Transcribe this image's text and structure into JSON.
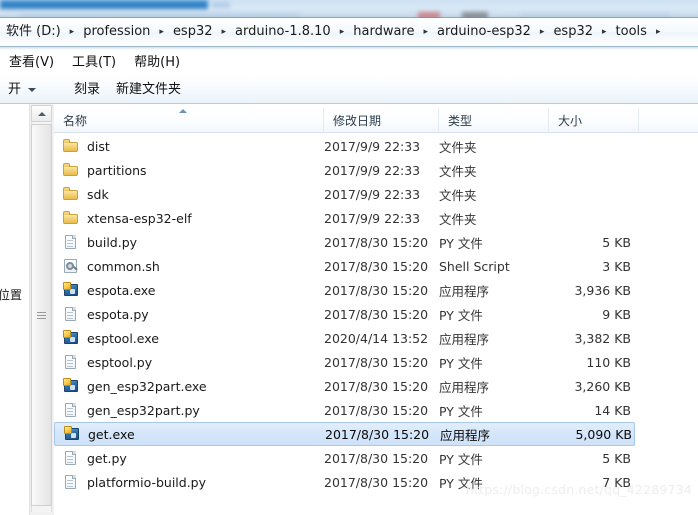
{
  "window": {
    "address_bar": {
      "crumbs": [
        "软件 (D:)",
        "profession",
        "esp32",
        "arduino-1.8.10",
        "hardware",
        "arduino-esp32",
        "esp32",
        "tools"
      ],
      "separator": "▸"
    },
    "menu": [
      {
        "label": "查看(V)"
      },
      {
        "label": "工具(T)"
      },
      {
        "label": "帮助(H)"
      }
    ],
    "toolbar": [
      {
        "label": "开",
        "icon": "chevron-down-icon"
      },
      {
        "label": "刻录"
      },
      {
        "label": "新建文件夹"
      }
    ],
    "nav_pane": {
      "clipped_label": "位置"
    }
  },
  "list": {
    "columns": [
      {
        "key": "name",
        "label": "名称",
        "sorted": "asc"
      },
      {
        "key": "date",
        "label": "修改日期"
      },
      {
        "key": "type",
        "label": "类型"
      },
      {
        "key": "size",
        "label": "大小"
      }
    ],
    "rows": [
      {
        "name": "dist",
        "date": "2017/9/9 22:33",
        "type": "文件夹",
        "size": "",
        "icon": "folder-icon",
        "selected": false
      },
      {
        "name": "partitions",
        "date": "2017/9/9 22:33",
        "type": "文件夹",
        "size": "",
        "icon": "folder-icon",
        "selected": false
      },
      {
        "name": "sdk",
        "date": "2017/9/9 22:33",
        "type": "文件夹",
        "size": "",
        "icon": "folder-icon",
        "selected": false
      },
      {
        "name": "xtensa-esp32-elf",
        "date": "2017/9/9 22:33",
        "type": "文件夹",
        "size": "",
        "icon": "folder-icon",
        "selected": false
      },
      {
        "name": "build.py",
        "date": "2017/8/30 15:20",
        "type": "PY 文件",
        "size": "5 KB",
        "icon": "py-file-icon",
        "selected": false
      },
      {
        "name": "common.sh",
        "date": "2017/8/30 15:20",
        "type": "Shell Script",
        "size": "3 KB",
        "icon": "shell-script-icon",
        "selected": false
      },
      {
        "name": "espota.exe",
        "date": "2017/8/30 15:20",
        "type": "应用程序",
        "size": "3,936 KB",
        "icon": "application-icon",
        "selected": false
      },
      {
        "name": "espota.py",
        "date": "2017/8/30 15:20",
        "type": "PY 文件",
        "size": "9 KB",
        "icon": "py-file-icon",
        "selected": false
      },
      {
        "name": "esptool.exe",
        "date": "2020/4/14 13:52",
        "type": "应用程序",
        "size": "3,382 KB",
        "icon": "application-icon",
        "selected": false
      },
      {
        "name": "esptool.py",
        "date": "2017/8/30 15:20",
        "type": "PY 文件",
        "size": "110 KB",
        "icon": "py-file-icon",
        "selected": false
      },
      {
        "name": "gen_esp32part.exe",
        "date": "2017/8/30 15:20",
        "type": "应用程序",
        "size": "3,260 KB",
        "icon": "application-icon",
        "selected": false
      },
      {
        "name": "gen_esp32part.py",
        "date": "2017/8/30 15:20",
        "type": "PY 文件",
        "size": "14 KB",
        "icon": "py-file-icon",
        "selected": false
      },
      {
        "name": "get.exe",
        "date": "2017/8/30 15:20",
        "type": "应用程序",
        "size": "5,090 KB",
        "icon": "application-icon",
        "selected": true
      },
      {
        "name": "get.py",
        "date": "2017/8/30 15:20",
        "type": "PY 文件",
        "size": "5 KB",
        "icon": "py-file-icon",
        "selected": false
      },
      {
        "name": "platformio-build.py",
        "date": "2017/8/30 15:20",
        "type": "PY 文件",
        "size": "7 KB",
        "icon": "py-file-icon",
        "selected": false
      }
    ]
  },
  "watermark": {
    "text": "https://blog.csdn.net/qq_42289734"
  },
  "colors": {
    "selection_fill": "#d4e6fa",
    "selection_border": "#a7c8ea",
    "address_border": "#9cb6cc",
    "folder_yellow": "#f3d071"
  }
}
